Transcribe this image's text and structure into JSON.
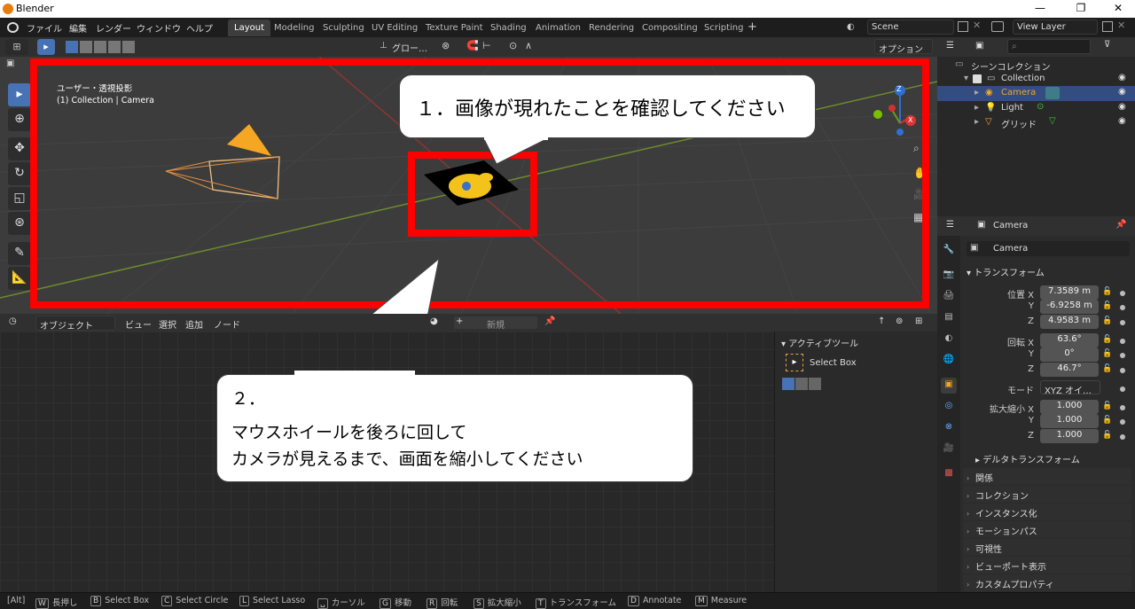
{
  "window": {
    "title": "Blender",
    "min": "—",
    "max": "❐",
    "close": "✕"
  },
  "menu": [
    "ファイル",
    "編集",
    "レンダー",
    "ウィンドウ",
    "ヘルプ"
  ],
  "workspaces": [
    "Layout",
    "Modeling",
    "Sculpting",
    "UV Editing",
    "Texture Paint",
    "Shading",
    "Animation",
    "Rendering",
    "Compositing",
    "Scripting"
  ],
  "add_ws": "+",
  "scene": {
    "name": "Scene",
    "view_layer": "View Layer"
  },
  "vpheader": {
    "orientation": "グロー…",
    "options": "オプション"
  },
  "viewport": {
    "view_name": "ユーザー・透視投影",
    "collection_label": "(1) Collection | Camera",
    "gizmo_z": "Z",
    "gizmo_x": "X"
  },
  "callouts": {
    "first": "１．画像が現れたことを確認してください",
    "second_num": "２．",
    "second_line1": "マウスホイールを後ろに回して",
    "second_line2": "カメラが見えるまで、画面を縮小してください"
  },
  "editor2": {
    "mode": "オブジェクト",
    "menus": [
      "ビュー",
      "選択",
      "追加",
      "ノード"
    ],
    "new_btn": "新規",
    "plus": "+"
  },
  "sidepanel": {
    "title": "アクティブツール",
    "tool": "Select Box"
  },
  "outliner": {
    "root": "シーンコレクション",
    "collection": "Collection",
    "camera": "Camera",
    "light": "Light",
    "grid": "グリッド"
  },
  "properties": {
    "header": "Camera",
    "object_name": "Camera",
    "transform": "トランスフォーム",
    "loc_label": "位置 X",
    "loc": [
      "7.3589 m",
      "-6.9258 m",
      "4.9583 m"
    ],
    "rot_label": "回転 X",
    "rot": [
      "63.6°",
      "0°",
      "46.7°"
    ],
    "mode_label": "モード",
    "mode": "XYZ オイ…",
    "scale_label": "拡大縮小 X",
    "scale": [
      "1.000",
      "1.000",
      "1.000"
    ],
    "y": "Y",
    "z": "Z",
    "delta": "デルタトランスフォーム",
    "sections": [
      "関係",
      "コレクション",
      "インスタンス化",
      "モーションパス",
      "可視性",
      "ビューポート表示",
      "カスタムプロパティ"
    ]
  },
  "status": [
    {
      "key": "W",
      "label": "長押し"
    },
    {
      "key": "B",
      "label": "Select Box"
    },
    {
      "key": "C",
      "label": "Select Circle"
    },
    {
      "key": "L",
      "label": "Select Lasso"
    },
    {
      "key": "␣",
      "label": "カーソル"
    },
    {
      "key": "G",
      "label": "移動"
    },
    {
      "key": "R",
      "label": "回転"
    },
    {
      "key": "S",
      "label": "拡大縮小"
    },
    {
      "key": "T",
      "label": "トランスフォーム"
    },
    {
      "key": "D",
      "label": "Annotate"
    },
    {
      "key": "M",
      "label": "Measure"
    }
  ],
  "alt_key": "[Alt]",
  "colors": {
    "accent": "#4772b3",
    "selected_row": "#334d80",
    "callout_border": "#ff0000",
    "camera_orange": "#f5a623"
  }
}
